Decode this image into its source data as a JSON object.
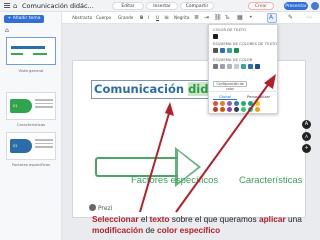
{
  "topbar": {
    "title": "Comunicación didác...",
    "edit_label": "Editar",
    "insert_label": "Insertar",
    "share_label": "Compartir",
    "video_label": "Crear video",
    "present_label": "Presentar"
  },
  "sidebar": {
    "add_topic_label": "+ Añadir tema",
    "thumbs": [
      {
        "label": "Vista general"
      },
      {
        "label": "Características",
        "mini_text": "01"
      },
      {
        "label": "Factores específicos",
        "mini_text": "02"
      }
    ]
  },
  "toolbar": {
    "items": [
      "Abstracto",
      "Cuerpo",
      "Grande",
      "B",
      "I",
      "U",
      "Negrita",
      "Tu"
    ]
  },
  "slide": {
    "title_part1": "Comunicación ",
    "title_highlight": "didáctica",
    "title_part3": " c",
    "label_left": "Factores específicos",
    "label_right": "Características",
    "logo_text": "Prezi"
  },
  "color_panel": {
    "section_text": "COLOR DE TEXTO",
    "section_theme": "ESQUEMA DE COLORES DE TEXTO",
    "section_scheme": "ESQUEMA DE COLOR",
    "config_label": "Configuración de color",
    "tab_global": "Global",
    "tab_custom": "Personalizar",
    "colors": {
      "text_black": "#1a1a1a",
      "theme_row": [
        "#555555",
        "#2f6fb4",
        "#3aa0a8",
        "#1f8e4d"
      ],
      "scheme_row": [
        "#777777",
        "#9aa3ad",
        "#aab4bf",
        "#c3cad2",
        "#3aa0a8",
        "#2f6fb4",
        "#1f4e8c"
      ],
      "palette_row1": [
        "#e74c3c",
        "#e67e22",
        "#9b59b6",
        "#2980b9",
        "#27ae60",
        "#16a085",
        "#f1c40f"
      ],
      "palette_row2": [
        "#c0392b",
        "#d35400",
        "#8e44ad",
        "#2c3e50",
        "#2ecc71",
        "#1abc9c",
        "#f39c12"
      ],
      "palette_row3": [
        "#34495e",
        "#7f8c8d",
        "#95a5a6",
        "#bdc3c7",
        "#ecf0f1",
        "#e8d56a",
        "#f5b041"
      ]
    }
  },
  "side_buttons": [
    "A",
    "A",
    "+"
  ],
  "caption": {
    "w1": "Seleccionar",
    "w2": " el ",
    "w3": "texto",
    "w4": " sobre el que queramos ",
    "w5": "aplicar",
    "w6": " una ",
    "w7": "modificación",
    "w8": " de ",
    "w9": "color específico"
  },
  "accent_colors": {
    "brand_blue": "#2f6fd6",
    "title_blue": "#2c6ca8",
    "green": "#3a9e59",
    "caption_red": "#b3202b"
  }
}
